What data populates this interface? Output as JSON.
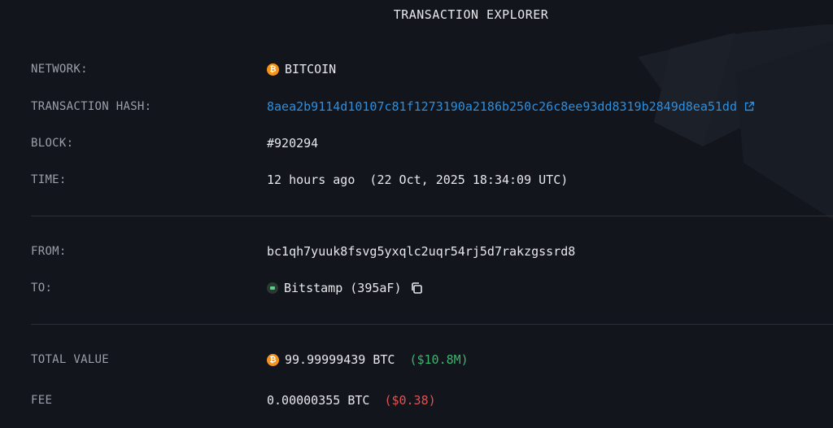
{
  "page": {
    "title": "TRANSACTION EXPLORER"
  },
  "details": {
    "network": {
      "label": "NETWORK:",
      "value": "BITCOIN",
      "icon": "bitcoin-icon"
    },
    "hash": {
      "label": "TRANSACTION HASH:",
      "value": "8aea2b9114d10107c81f1273190a2186b250c26c8ee93dd8319b2849d8ea51dd",
      "icon": "external-link-icon"
    },
    "block": {
      "label": "BLOCK:",
      "value": "#920294"
    },
    "time": {
      "label": "TIME:",
      "value": "12 hours ago  (22 Oct, 2025 18:34:09 UTC)"
    }
  },
  "parties": {
    "from": {
      "label": "FROM:",
      "value": "bc1qh7yuuk8fsvg5yxqlc2uqr54rj5d7rakzgssrd8"
    },
    "to": {
      "label": "TO:",
      "value": "Bitstamp (395aF)",
      "icon": "entity-icon",
      "action_icon": "copy-icon"
    }
  },
  "amounts": {
    "total": {
      "label": "TOTAL VALUE",
      "value": "99.99999439 BTC",
      "usd": "($10.8M)",
      "usd_color": "#3db46d",
      "icon": "bitcoin-icon"
    },
    "fee": {
      "label": "FEE",
      "value": "0.00000355 BTC",
      "usd": "($0.38)",
      "usd_color": "#e05252"
    }
  },
  "colors": {
    "background": "#12151c",
    "link": "#2b8fe0",
    "bitcoin": "#f7931a"
  }
}
